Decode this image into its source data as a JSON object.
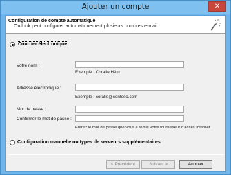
{
  "window": {
    "title": "Ajouter un compte",
    "close_glyph": "✕"
  },
  "header": {
    "title": "Configuration de compte automatique",
    "subtitle": "Outlook peut configurer automatiquement plusieurs comptes e-mail.",
    "icon": "magic-wand-icon"
  },
  "options": {
    "email_label": "Courrier électronique",
    "email_selected": true,
    "manual_label": "Configuration manuelle ou types de serveurs supplémentaires",
    "manual_selected": false
  },
  "form": {
    "name_label": "Votre nom :",
    "name_value": "",
    "name_hint": "Exemple : Coralie Hétu",
    "email_label": "Adresse électronique :",
    "email_value": "",
    "email_hint": "Exemple : coralie@contoso.com",
    "password_label": "Mot de passe :",
    "password_value": "",
    "confirm_label": "Confirmer le mot de passe :",
    "confirm_value": "",
    "password_hint": "Entrez le mot de passe que vous a remis votre fournisseur d'accès Internet."
  },
  "buttons": {
    "back": "< Précédent",
    "next": "Suivant >",
    "cancel": "Annuler"
  }
}
